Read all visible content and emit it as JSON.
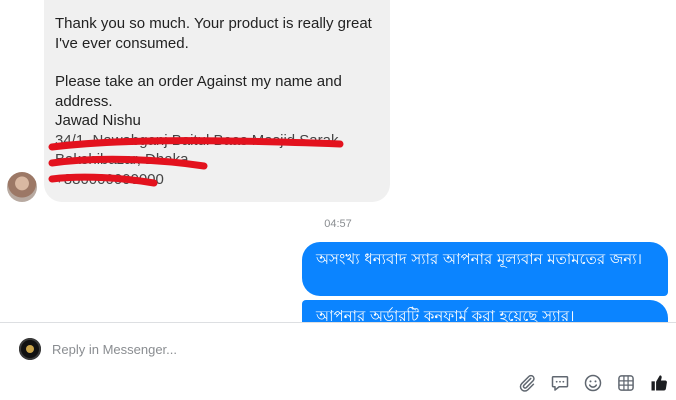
{
  "incoming_message": {
    "line1": "Thank you so much. Your product is really great\nI've ever consumed.",
    "line2": "Please take an order Against my name and\naddress.",
    "name": "Jawad Nishu",
    "address_redacted": "34/1, Nawabganj Baitul Baas Masjid Sarak\nBakshibazar, Dhaka\n+880000000000"
  },
  "timestamp": "04:57",
  "outgoing_messages": [
    "অসংখ্য ধন্যবাদ স্যার আপনার মূল্যবান মতামতের জন্য।",
    "আপনার অর্ডারটি কনফার্ম করা হয়েছে স্যার।"
  ],
  "composer": {
    "placeholder": "Reply in Messenger...",
    "tools": [
      "attachment-icon",
      "chat-bubble-icon",
      "emoji-icon",
      "gif-icon",
      "thumbs-up-icon"
    ]
  },
  "colors": {
    "incoming_bg": "#f0f0f0",
    "outgoing_bg": "#0b84ff",
    "redaction": "#e3121e"
  }
}
